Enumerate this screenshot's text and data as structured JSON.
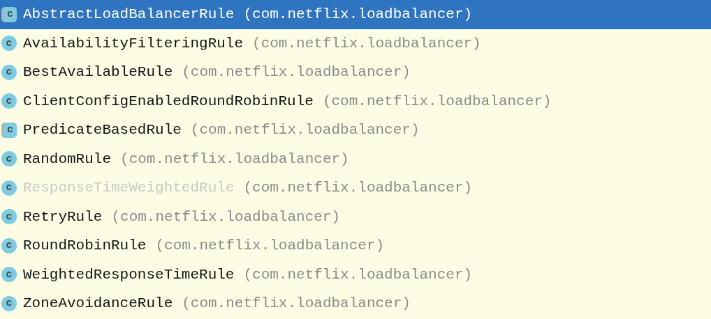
{
  "items": [
    {
      "name": "AbstractLoadBalancerRule",
      "package": "(com.netflix.loadbalancer)",
      "icon_letter": "c",
      "kind": "abstract",
      "deprecated": false,
      "selected": true
    },
    {
      "name": "AvailabilityFilteringRule",
      "package": "(com.netflix.loadbalancer)",
      "icon_letter": "c",
      "kind": "class",
      "deprecated": false,
      "selected": false
    },
    {
      "name": "BestAvailableRule",
      "package": "(com.netflix.loadbalancer)",
      "icon_letter": "c",
      "kind": "class",
      "deprecated": false,
      "selected": false
    },
    {
      "name": "ClientConfigEnabledRoundRobinRule",
      "package": "(com.netflix.loadbalancer)",
      "icon_letter": "c",
      "kind": "class",
      "deprecated": false,
      "selected": false
    },
    {
      "name": "PredicateBasedRule",
      "package": "(com.netflix.loadbalancer)",
      "icon_letter": "c",
      "kind": "abstract",
      "deprecated": false,
      "selected": false
    },
    {
      "name": "RandomRule",
      "package": "(com.netflix.loadbalancer)",
      "icon_letter": "c",
      "kind": "class",
      "deprecated": false,
      "selected": false
    },
    {
      "name": "ResponseTimeWeightedRule",
      "package": "(com.netflix.loadbalancer)",
      "icon_letter": "c",
      "kind": "class",
      "deprecated": true,
      "selected": false
    },
    {
      "name": "RetryRule",
      "package": "(com.netflix.loadbalancer)",
      "icon_letter": "c",
      "kind": "class",
      "deprecated": false,
      "selected": false
    },
    {
      "name": "RoundRobinRule",
      "package": "(com.netflix.loadbalancer)",
      "icon_letter": "c",
      "kind": "class",
      "deprecated": false,
      "selected": false
    },
    {
      "name": "WeightedResponseTimeRule",
      "package": "(com.netflix.loadbalancer)",
      "icon_letter": "c",
      "kind": "class",
      "deprecated": false,
      "selected": false
    },
    {
      "name": "ZoneAvoidanceRule",
      "package": "(com.netflix.loadbalancer)",
      "icon_letter": "c",
      "kind": "class",
      "deprecated": false,
      "selected": false
    }
  ]
}
